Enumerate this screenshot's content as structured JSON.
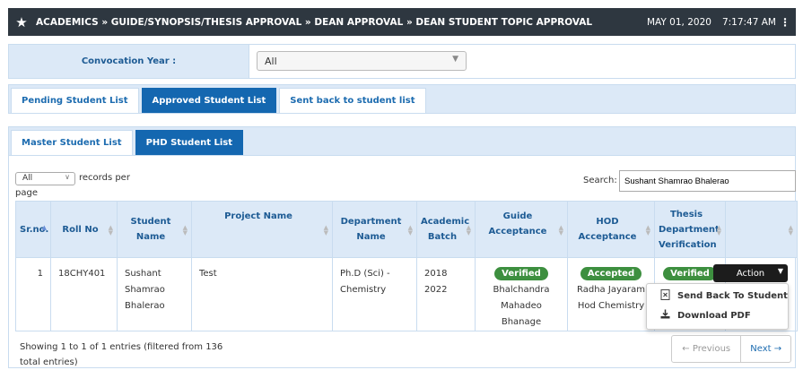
{
  "header": {
    "breadcrumb": "ACADEMICS » GUIDE/SYNOPSIS/THESIS APPROVAL » DEAN APPROVAL » DEAN STUDENT TOPIC APPROVAL",
    "date": "MAY 01, 2020",
    "time": "7:17:47 AM"
  },
  "filter": {
    "convocation_label": "Convocation Year :",
    "convocation_value": "All"
  },
  "tabs_primary": [
    {
      "label": "Pending Student List",
      "active": false
    },
    {
      "label": "Approved Student List",
      "active": true
    },
    {
      "label": "Sent back to student list",
      "active": false
    }
  ],
  "tabs_secondary": [
    {
      "label": "Master Student List",
      "active": false
    },
    {
      "label": "PHD Student List",
      "active": true
    }
  ],
  "table_controls": {
    "records_value": "All",
    "records_label": "records per",
    "records_label2": "page",
    "search_label": "Search:",
    "search_value": "Sushant Shamrao Bhalerao"
  },
  "columns": [
    "Sr.no.",
    "Roll No",
    "Student Name",
    "Project Name",
    "Department Name",
    "Academic Batch",
    "Guide Acceptance",
    "HOD Acceptance",
    "Thesis Department Verification",
    ""
  ],
  "row": {
    "srno": "1",
    "rollno": "18CHY401",
    "student_name": "Sushant Shamrao Bhalerao",
    "project_name": "Test",
    "department": "Ph.D (Sci) - Chemistry",
    "batch": "2018 2022",
    "guide_status": "Verified",
    "guide_name": "Bhalchandra Mahadeo Bhanage",
    "hod_status": "Accepted",
    "hod_name": "Radha Jayaram Hod Chemistry",
    "thesis_status": "Verified",
    "action_label": "Action"
  },
  "action_menu": [
    {
      "label": "Send Back To Student",
      "icon": "file-x-icon"
    },
    {
      "label": "Download PDF",
      "icon": "download-icon"
    }
  ],
  "footer": {
    "showing": "Showing 1 to 1 of 1 entries (filtered from 136 total entries)",
    "prev": "← Previous",
    "next": "Next →"
  },
  "colors": {
    "topbar": "#2e3740",
    "tab_active": "#1467b0",
    "badge": "#3d8f3f",
    "header_bg": "#dce9f7"
  }
}
